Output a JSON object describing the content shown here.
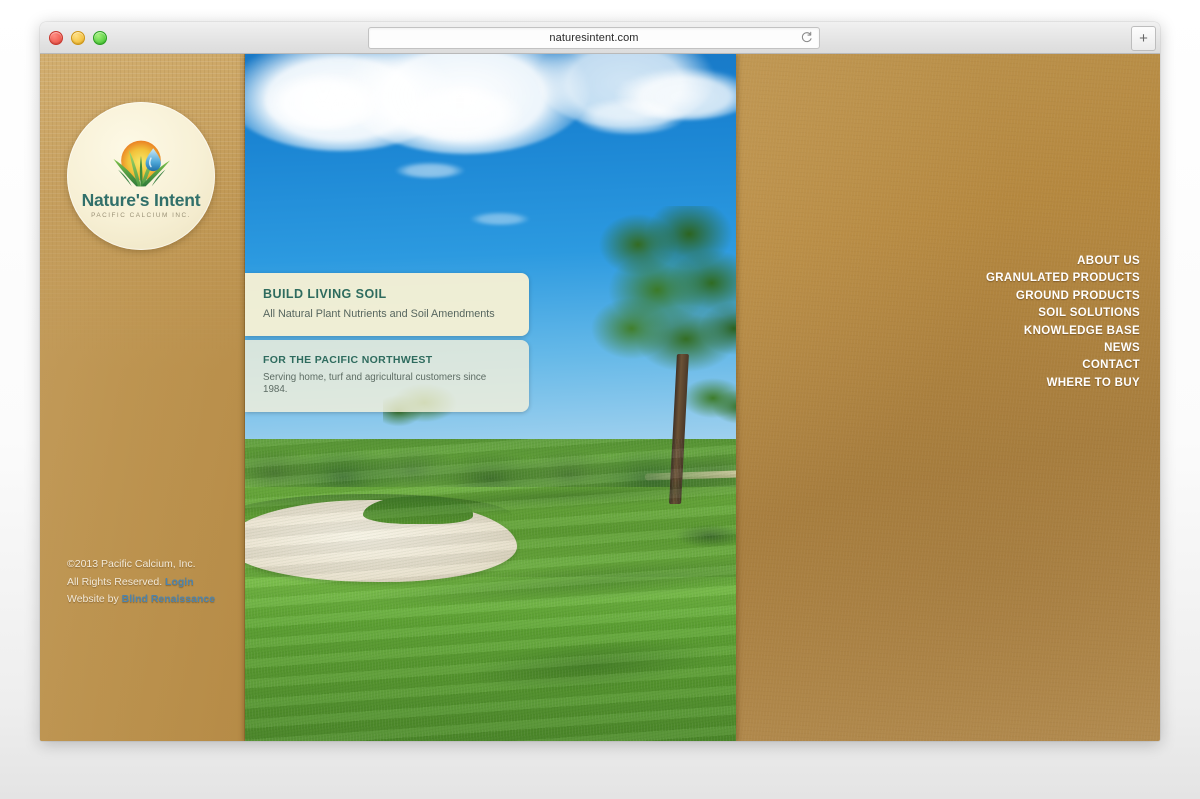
{
  "browser": {
    "url": "naturesintent.com",
    "reload_icon": "reload-icon",
    "newtab_label": "+",
    "traffic_lights": [
      "close",
      "minimize",
      "maximize"
    ]
  },
  "site": {
    "logo": {
      "name": "Nature's Intent",
      "tagline": "PACIFIC CALCIUM INC.",
      "mark": "sun-grass-waterdrop-icon"
    },
    "nav": {
      "items": [
        {
          "label": "ABOUT US"
        },
        {
          "label": "GRANULATED PRODUCTS"
        },
        {
          "label": "GROUND PRODUCTS"
        },
        {
          "label": "SOIL SOLUTIONS"
        },
        {
          "label": "KNOWLEDGE BASE"
        },
        {
          "label": "NEWS"
        },
        {
          "label": "CONTACT"
        },
        {
          "label": "WHERE TO BUY"
        }
      ]
    },
    "hero": {
      "image_alt": "golf course fairway with sand bunker, trees and blue sky",
      "callouts": [
        {
          "title": "BUILD LIVING SOIL",
          "subtitle": "All Natural Plant Nutrients and Soil Amendments"
        },
        {
          "title": "FOR THE PACIFIC NORTHWEST",
          "subtitle": "Serving home, turf and agricultural customers since 1984."
        }
      ]
    },
    "footer": {
      "copyright": "©2013 Pacific Calcium, Inc.",
      "rights": "All Rights Reserved.",
      "login_label": "Login",
      "credit_prefix": "Website by",
      "credit_link": "Blind Renaissance"
    },
    "colors": {
      "background_tan": "#b5883f",
      "sidebar_tan": "#bd9450",
      "heading_teal": "#2e6b5e",
      "link_blue": "#4d84ad",
      "logo_teal": "#31706a",
      "callout_cream": "#f6f0d4"
    }
  }
}
